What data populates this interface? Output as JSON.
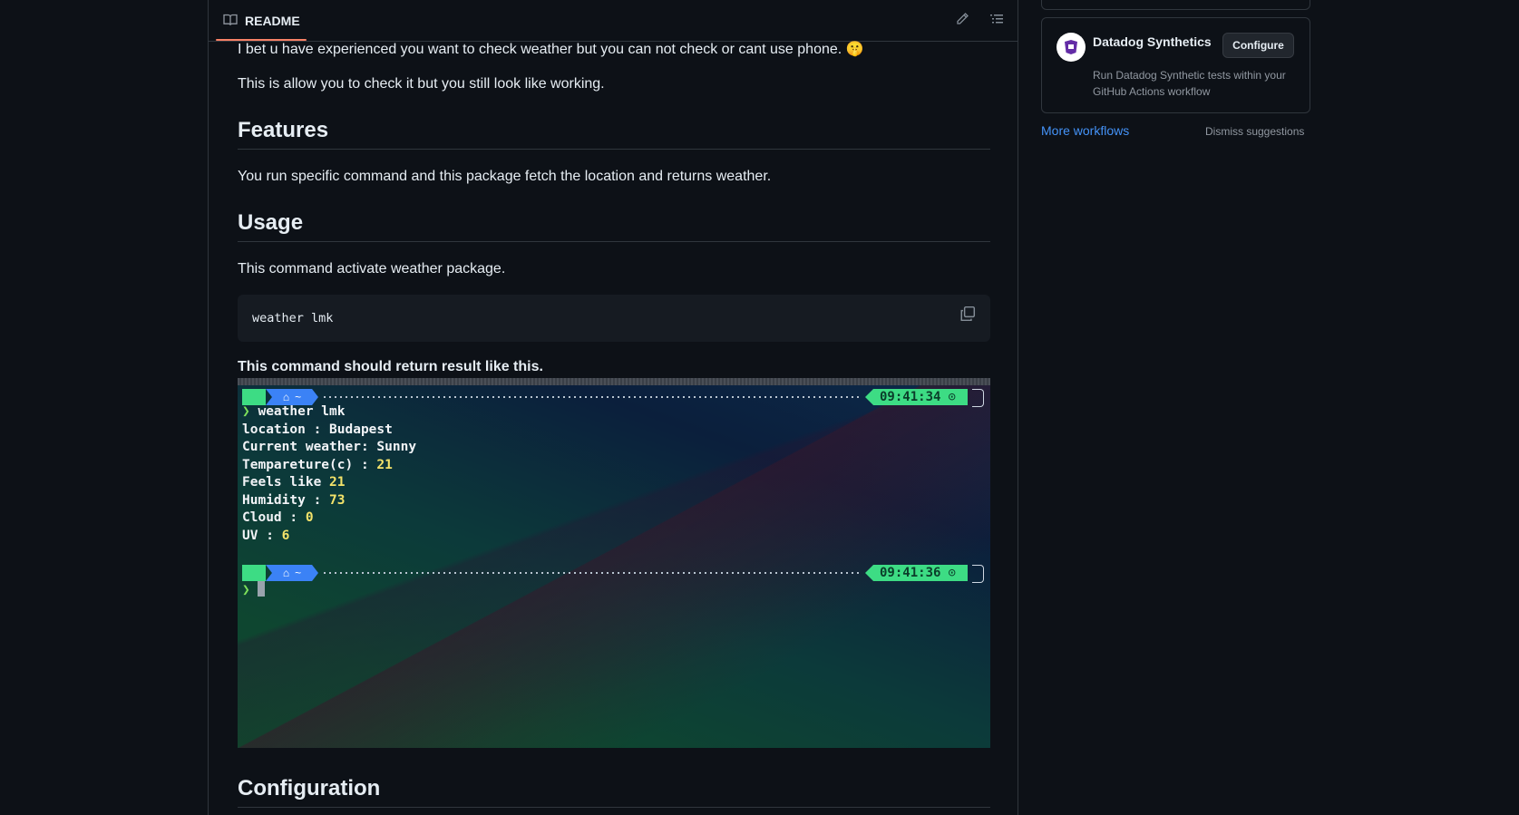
{
  "readme": {
    "tab_label": "README",
    "intro_line1": "I bet u have experienced you want to check weather but you can not check or cant use phone. 🤫",
    "intro_line2": "This is allow you to check it but you still look like working.",
    "features_heading": "Features",
    "features_text": "You run specific command and this package fetch the location and returns weather.",
    "usage_heading": "Usage",
    "usage_text": "This command activate weather package.",
    "code": "weather lmk",
    "result_text": "This command should return result like this.",
    "config_heading": "Configuration"
  },
  "terminal": {
    "time1": "09:41:34",
    "time2": "09:41:36",
    "home_glyph": "~",
    "command": "weather lmk",
    "lines": [
      {
        "label": "location : Budapest",
        "value": ""
      },
      {
        "label": "Current weather: Sunny",
        "value": ""
      },
      {
        "label": "Tempareture(c) : ",
        "value": "21"
      },
      {
        "label": "Feels like ",
        "value": "21"
      },
      {
        "label": "Humidity : ",
        "value": "73"
      },
      {
        "label": "Cloud : ",
        "value": "0"
      },
      {
        "label": "UV : ",
        "value": "6"
      }
    ]
  },
  "sidebar": {
    "card_title": "Datadog Synthetics",
    "configure_label": "Configure",
    "card_desc": "Run Datadog Synthetic tests within your GitHub Actions workflow",
    "more_workflows": "More workflows",
    "dismiss": "Dismiss suggestions"
  },
  "icons": [
    "book-icon",
    "pencil-icon",
    "list-icon",
    "copy-icon",
    "apple-icon",
    "home-icon",
    "clock-icon",
    "datadog-logo-icon"
  ]
}
